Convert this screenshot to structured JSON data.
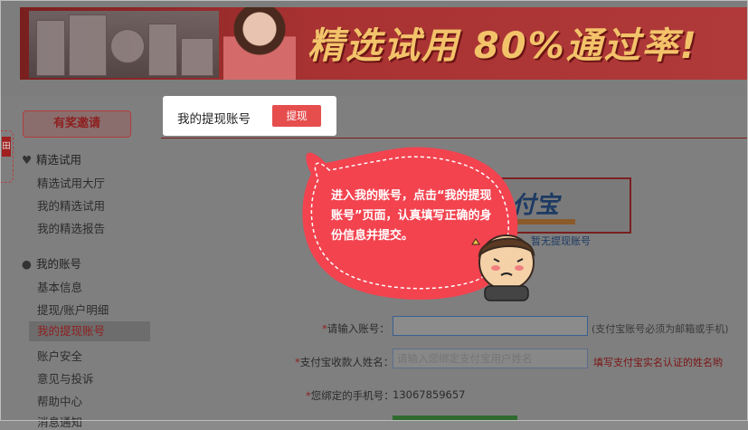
{
  "banner": {
    "headline": "精选试用 80%通过率!"
  },
  "sidebar": {
    "invite_button": "有奖邀请",
    "side_tab_label": "田",
    "groups": [
      {
        "title": "精选试用",
        "icon": "heart-icon",
        "items": [
          "精选试用大厅",
          "我的精选试用",
          "我的精选报告"
        ]
      },
      {
        "title": "我的账号",
        "icon": "user-icon",
        "items": [
          "基本信息",
          "提现/账户明细",
          "我的提现账号",
          "账户安全",
          "意见与投诉",
          "帮助中心",
          "消息通知"
        ]
      }
    ],
    "active_item": "我的提现账号"
  },
  "main": {
    "tab_title": "我的提现账号",
    "tab_button": "提现",
    "alipay_logo_text": "付宝",
    "alipay_link": "暂无提现账号",
    "form": {
      "account_label_star": "*",
      "account_label": "请输入账号：",
      "account_value": "",
      "account_hint": "(支付宝账号必须为邮箱或手机)",
      "name_label_star": "*",
      "name_label": "支付宝收款人姓名：",
      "name_placeholder": "请输入您绑定支付宝用户姓名",
      "name_hint": "填写支付宝实名认证的姓名哟",
      "phone_label_star": "*",
      "phone_label": "您绑定的手机号：",
      "phone_value": "13067859657"
    }
  },
  "callout": {
    "text": "进入我的账号，点击“我的提现账号”页面，认真填写正确的身份信息并提交。"
  },
  "colors": {
    "accent": "#e64e4e",
    "bubble": "#f2434f",
    "dim_overlay": "#7f7f7f"
  }
}
